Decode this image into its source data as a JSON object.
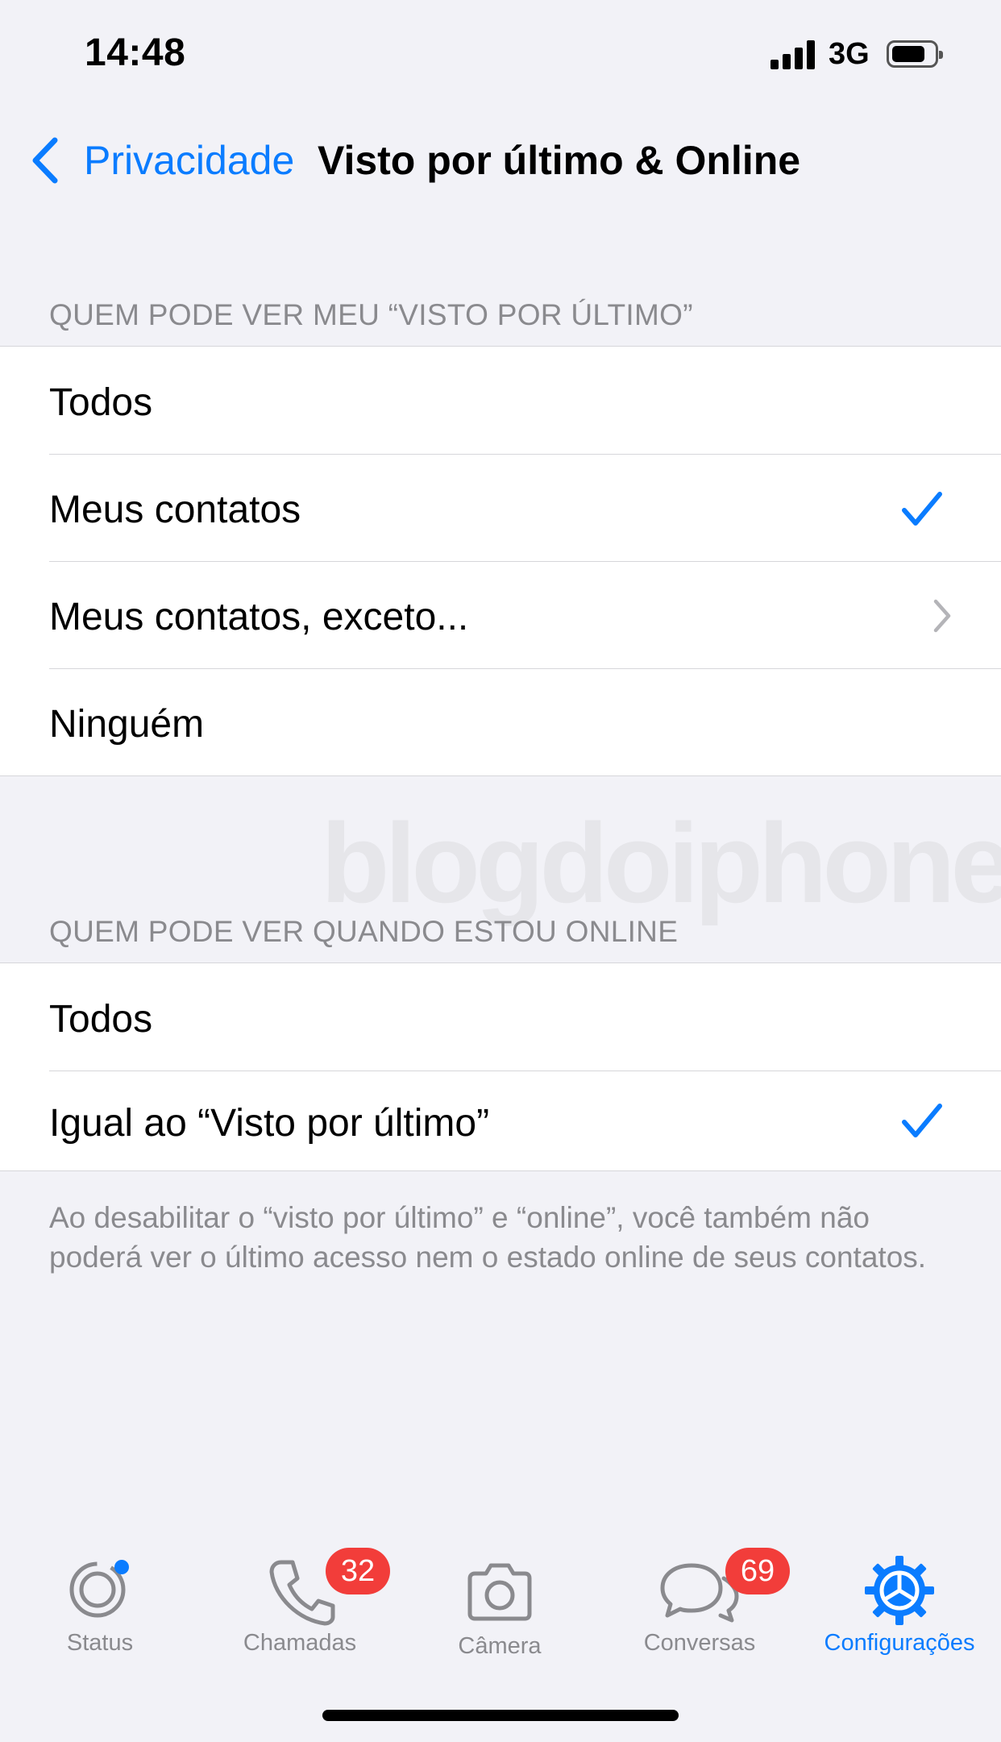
{
  "status_bar": {
    "time": "14:48",
    "network": "3G"
  },
  "nav": {
    "back_label": "Privacidade",
    "title": "Visto por último & Online"
  },
  "last_seen_section": {
    "header": "QUEM PODE VER MEU “VISTO POR ÚLTIMO”",
    "options": [
      {
        "label": "Todos"
      },
      {
        "label": "Meus contatos",
        "selected": true
      },
      {
        "label": "Meus contatos, exceto..."
      },
      {
        "label": "Ninguém"
      }
    ]
  },
  "online_section": {
    "header": "QUEM PODE VER QUANDO ESTOU ONLINE",
    "options": [
      {
        "label": "Todos"
      },
      {
        "label": "Igual ao “Visto por último”",
        "selected": true
      }
    ]
  },
  "footer_note": "Ao desabilitar o “visto por último” e “online”, você também não poderá ver o último acesso nem o estado online de seus contatos.",
  "watermark": "blogdoiphone",
  "tab_bar": {
    "tabs": [
      {
        "label": "Status",
        "icon": "status-icon"
      },
      {
        "label": "Chamadas",
        "icon": "phone-icon",
        "badge": "32"
      },
      {
        "label": "Câmera",
        "icon": "camera-icon"
      },
      {
        "label": "Conversas",
        "icon": "chat-bubbles-icon",
        "badge": "69"
      },
      {
        "label": "Configurações",
        "icon": "gear-icon",
        "active": true
      }
    ]
  },
  "colors": {
    "accent": "#0a7cff",
    "badge": "#f23d3a",
    "background": "#f2f2f7"
  }
}
